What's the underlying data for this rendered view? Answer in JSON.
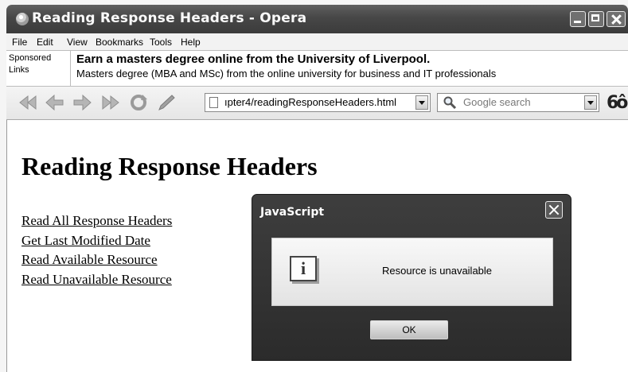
{
  "window": {
    "title": "Reading Response Headers - Opera"
  },
  "menu": [
    "File",
    "Edit",
    "View",
    "Bookmarks",
    "Tools",
    "Help"
  ],
  "sponsored": {
    "label_line1": "Sponsored",
    "label_line2": "Links",
    "headline": "Earn a masters degree online from the University of Liverpool.",
    "subline": "Masters degree (MBA and MSc) from the online university for business and IT professionals"
  },
  "toolbar": {
    "address": "ıpter4/readingResponseHeaders.html",
    "search_placeholder": "Google search"
  },
  "page": {
    "heading": "Reading Response Headers",
    "links": [
      "Read All Response Headers",
      "Get Last Modified Date",
      "Read Available Resource",
      "Read Unavailable Resource"
    ]
  },
  "dialog": {
    "title": "JavaScript",
    "message": "Resource is unavailable",
    "ok_label": "OK",
    "icon": "info-icon",
    "icon_glyph": "i"
  }
}
